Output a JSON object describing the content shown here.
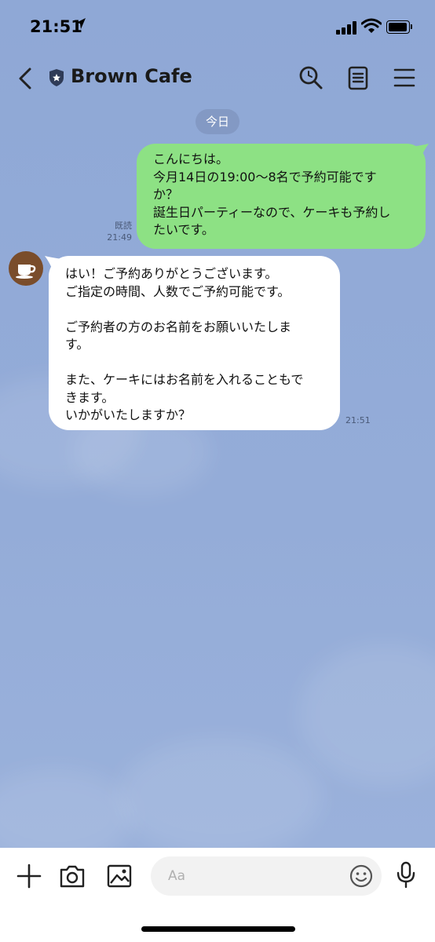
{
  "status_bar": {
    "time": "21:51"
  },
  "header": {
    "title": "Brown Cafe"
  },
  "date_separator": "今日",
  "messages": {
    "sent": {
      "text": "こんにちは。\n今月14日の19:00〜8名で予約可能です\nか？\n誕生日パーティーなので、ケーキも予約し\nたいです。",
      "read_label": "既読",
      "time": "21:49"
    },
    "received": {
      "text": "はい！ご予約ありがとうございます。\nご指定の時間、人数でご予約可能です。\n\nご予約者の方のお名前をお願いいたしま\nす。\n\nまた、ケーキにはお名前を入れることもで\nきます。\nいかがいたしますか？",
      "time": "21:51"
    }
  },
  "input": {
    "placeholder": "Aa"
  },
  "colors": {
    "background": "#91a9d6",
    "sent_bubble": "#8de184",
    "received_bubble": "#ffffff"
  }
}
